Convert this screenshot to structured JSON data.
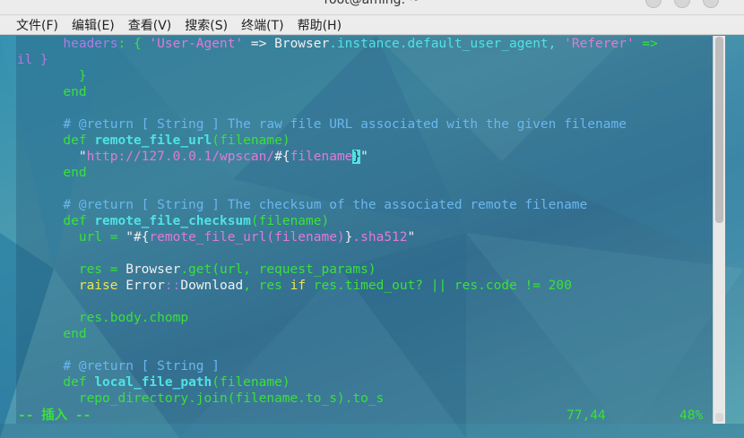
{
  "window": {
    "title": "root@aming: ~"
  },
  "menubar": {
    "items": [
      {
        "label": "文件(F)"
      },
      {
        "label": "编辑(E)"
      },
      {
        "label": "查看(V)"
      },
      {
        "label": "搜索(S)"
      },
      {
        "label": "终端(T)"
      },
      {
        "label": "帮助(H)"
      }
    ]
  },
  "editor": {
    "lines": {
      "l1": {
        "indent": "      ",
        "kw": "headers",
        "sep": ": { ",
        "s1": "'User-Agent'",
        "op": " => ",
        "cls": "Browser",
        "rest": ".instance.default_user_agent, ",
        "s2": "'Referer'",
        "op2": " =>"
      },
      "l1b": {
        "text": "nil }"
      },
      "l2": {
        "text": "        }"
      },
      "l3": {
        "text": "      end"
      },
      "l5": {
        "text": "      # @return [ String ] The raw file URL associated with the given filename"
      },
      "l6": {
        "def": "      def ",
        "name": "remote_file_url",
        "args": "(filename)"
      },
      "l7": {
        "q1": "        \"",
        "url": "http://127.0.0.1/wpscan/",
        "hash": "#",
        "b1": "{",
        "var": "filename",
        "b2": "}",
        "q2": "\""
      },
      "l8": {
        "text": "      end"
      },
      "l10": {
        "text": "      # @return [ String ] The checksum of the associated remote filename"
      },
      "l11": {
        "def": "      def ",
        "name": "remote_file_checksum",
        "args": "(filename)"
      },
      "l12": {
        "a": "        url = ",
        "q1": "\"",
        "hash": "#",
        "b1": "{",
        "inner": "remote_file_url(filename)",
        "b2": "}",
        "rest": ".sha512",
        "q2": "\""
      },
      "l14": {
        "a": "        res = ",
        "cls": "Browser",
        "rest": ".get(url, request_params)"
      },
      "l15": {
        "a": "        ",
        "kw": "raise",
        "sp": " ",
        "cls": "Error",
        "sep": "::",
        "cls2": "Download",
        "m": ", res ",
        "kw2": "if",
        "rest": " res.timed_out? || res.code != 200"
      },
      "l17": {
        "text": "        res.body.chomp"
      },
      "l18": {
        "text": "      end"
      },
      "l20": {
        "text": "      # @return [ String ]"
      },
      "l21": {
        "def": "      def ",
        "name": "local_file_path",
        "args": "(filename)"
      },
      "l22": {
        "text": "        repo_directory.join(filename.to_s).to_s"
      }
    }
  },
  "status": {
    "mode": "-- 插入 --",
    "position": "77,44",
    "percent": "48%"
  }
}
